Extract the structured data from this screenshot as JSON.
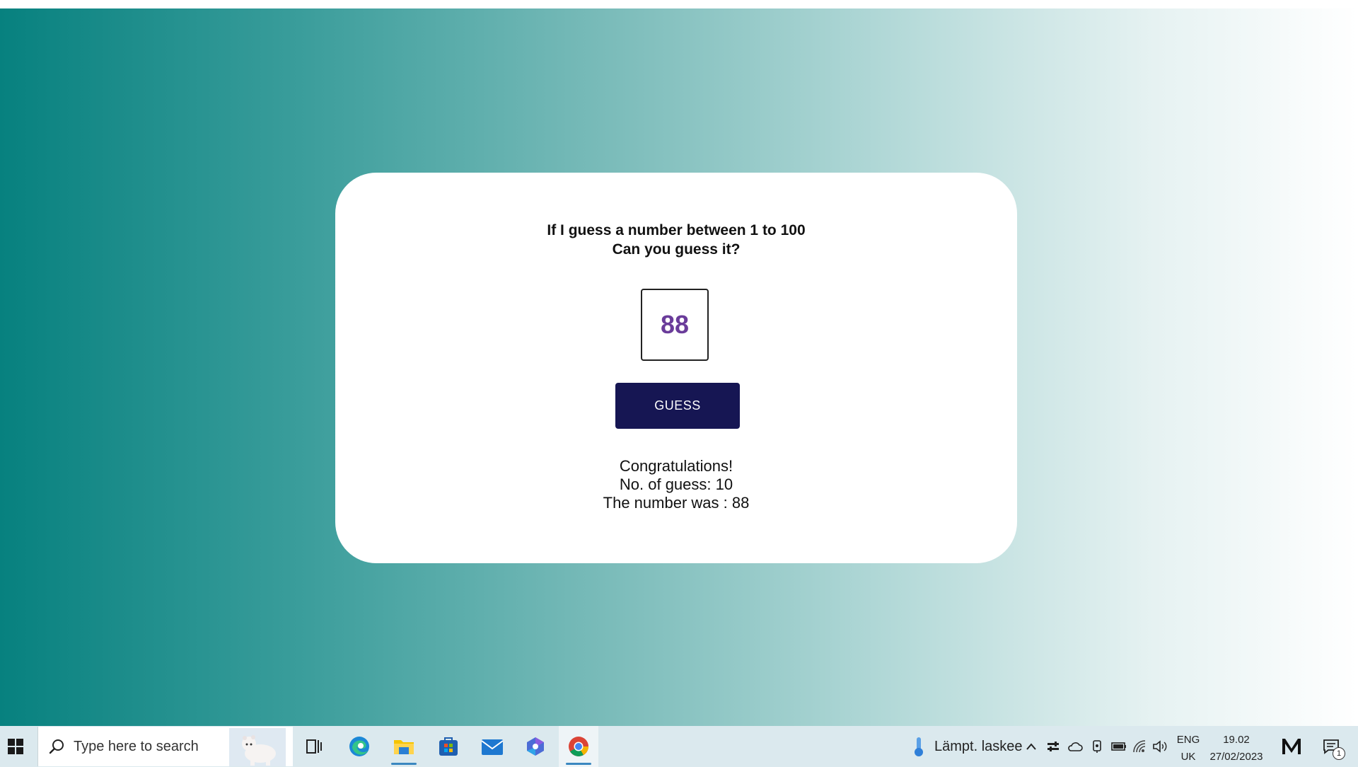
{
  "game": {
    "heading_line1": "If I guess a number between 1 to 100",
    "heading_line2": "Can you guess it?",
    "input_value": "88",
    "guess_button": "GUESS",
    "result_line1": "Congratulations!",
    "result_line2": "No. of guess: 10",
    "result_line3": "The number was : 88"
  },
  "taskbar": {
    "search_placeholder": "Type here to search",
    "weather": "Lämpt. laskee",
    "lang_line1": "ENG",
    "lang_line2": "UK",
    "time": "19.02",
    "date": "27/02/2023",
    "notification_count": "1",
    "pinned_apps": [
      "task-view",
      "edge",
      "file-explorer",
      "microsoft-store",
      "mail",
      "copilot",
      "chrome"
    ]
  },
  "colors": {
    "gradient_start": "#07817f",
    "gradient_end": "#ffffff",
    "button_bg": "#161653",
    "number_color": "#6a3c9a"
  }
}
